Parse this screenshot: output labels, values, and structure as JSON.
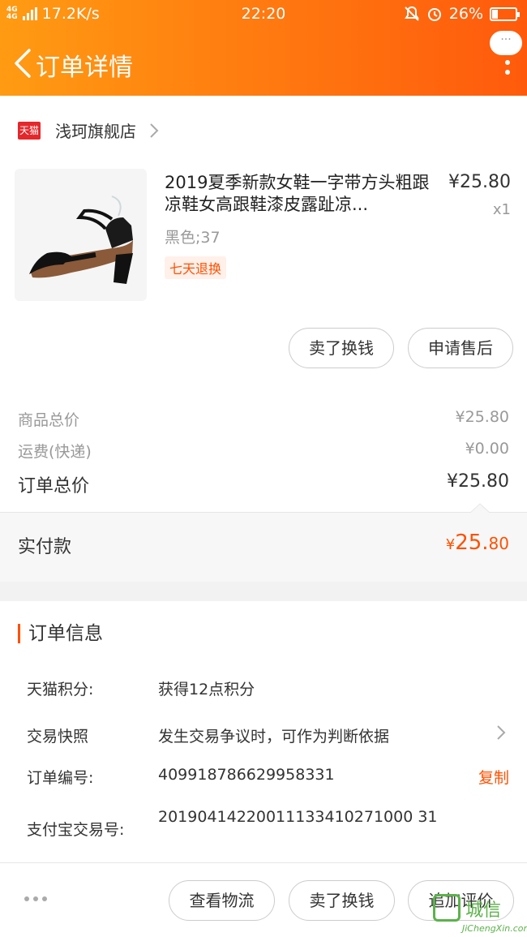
{
  "status_bar": {
    "network": "4G 4G",
    "speed": "17.2K/s",
    "time": "22:20",
    "battery": "26%",
    "battery_level": 0.26
  },
  "header": {
    "title": "订单详情",
    "more_bubble": "···"
  },
  "shop": {
    "badge": "天猫",
    "name": "浅珂旗舰店"
  },
  "product": {
    "title": "2019夏季新款女鞋一字带方头粗跟凉鞋女高跟鞋漆皮露趾凉...",
    "price": "¥25.80",
    "qty": "x1",
    "spec": "黑色;37",
    "tag": "七天退换"
  },
  "item_actions": {
    "sell": "卖了换钱",
    "after_sale": "申请售后"
  },
  "summary": {
    "goods_label": "商品总价",
    "goods_value": "¥25.80",
    "shipping_label": "运费(快递)",
    "shipping_value": "¥0.00",
    "total_label": "订单总价",
    "total_value": "¥25.80",
    "paid_label": "实付款",
    "paid_currency": "¥",
    "paid_int": "25.",
    "paid_dec": "80"
  },
  "order_info": {
    "title": "订单信息",
    "points_label": "天猫积分:",
    "points_value": "获得12点积分",
    "snapshot_label": "交易快照",
    "snapshot_value": "发生交易争议时，可作为判断依据",
    "order_no_label": "订单编号:",
    "order_no_value": "409918786629958331",
    "copy_label": "复制",
    "alipay_label": "支付宝交易号:",
    "alipay_value": "20190414220011133410271000 31"
  },
  "bottom": {
    "logistics": "查看物流",
    "sell": "卖了换钱",
    "review": "追加评价"
  },
  "watermark": {
    "cn": "城信",
    "en": "JiChengXin.com"
  },
  "colors": {
    "accent": "#ff5000",
    "header_start": "#ff9b12",
    "header_end": "#ff5a0c"
  }
}
